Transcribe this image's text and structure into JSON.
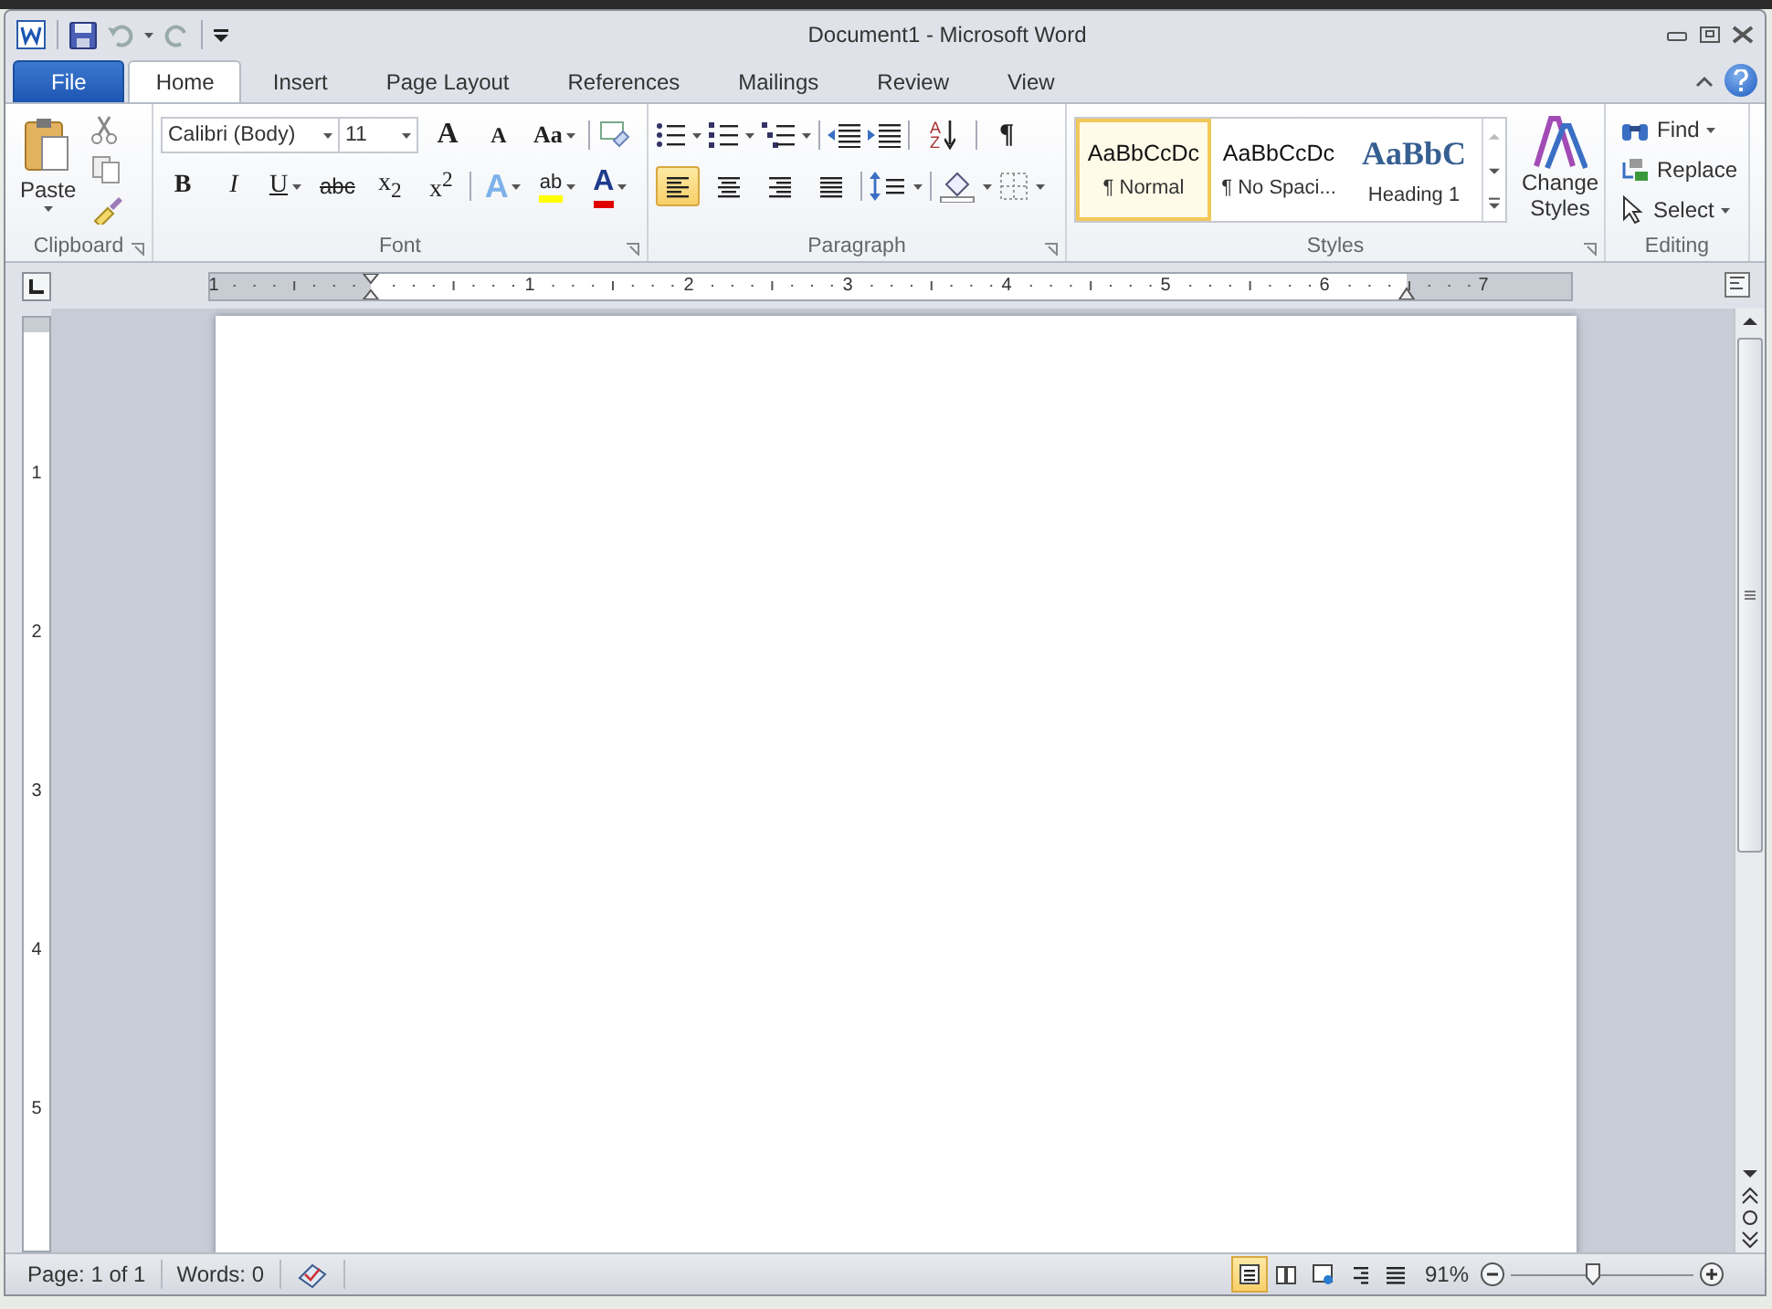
{
  "window": {
    "title": "Document1 - Microsoft Word"
  },
  "tabs": [
    {
      "label": "File",
      "kind": "file",
      "selected": false
    },
    {
      "label": "Home",
      "kind": "tab",
      "selected": true
    },
    {
      "label": "Insert",
      "kind": "tab",
      "selected": false
    },
    {
      "label": "Page Layout",
      "kind": "tab",
      "selected": false
    },
    {
      "label": "References",
      "kind": "tab",
      "selected": false
    },
    {
      "label": "Mailings",
      "kind": "tab",
      "selected": false
    },
    {
      "label": "Review",
      "kind": "tab",
      "selected": false
    },
    {
      "label": "View",
      "kind": "tab",
      "selected": false
    }
  ],
  "clipboard": {
    "paste": "Paste",
    "label": "Clipboard"
  },
  "font": {
    "family": "Calibri (Body)",
    "size": "11",
    "label": "Font",
    "tools": [
      {
        "kind": "grow",
        "label": "A"
      },
      {
        "kind": "shrink",
        "label": "A"
      },
      {
        "kind": "case",
        "label": "Aa"
      }
    ],
    "formats": [
      {
        "kind": "bold",
        "label": "B"
      },
      {
        "kind": "italic",
        "label": "I"
      },
      {
        "kind": "underline",
        "label": "U"
      },
      {
        "kind": "strike",
        "label": "abc"
      },
      {
        "kind": "sub",
        "label": "x$_{2}$"
      },
      {
        "kind": "sup",
        "label": "x$^{2}$"
      }
    ],
    "colors": [
      {
        "kind": "effects",
        "label": "A"
      },
      {
        "kind": "highlight",
        "label": "ab",
        "color": "#ffff00"
      },
      {
        "kind": "fontcolor",
        "label": "A",
        "color": "#e00000"
      }
    ]
  },
  "paragraph": {
    "label": "Paragraph",
    "pilcrow": "¶",
    "sort_label": "A Z",
    "align": [
      {
        "kind": "left",
        "selected": true
      },
      {
        "kind": "center",
        "selected": false
      },
      {
        "kind": "right",
        "selected": false
      },
      {
        "kind": "justify",
        "selected": false
      }
    ]
  },
  "styles": {
    "label": "Styles",
    "change": "Change Styles",
    "items": [
      {
        "kind": "normal",
        "preview": "AaBbCcDc",
        "name": "¶ Normal",
        "selected": true
      },
      {
        "kind": "normal",
        "preview": "AaBbCcDc",
        "name": "¶ No Spaci...",
        "selected": false
      },
      {
        "kind": "heading",
        "preview": "AaBbC",
        "name": "Heading 1",
        "selected": false
      }
    ]
  },
  "editing": {
    "label": "Editing",
    "items": [
      {
        "kind": "find",
        "label": "Find"
      },
      {
        "kind": "replace",
        "label": "Replace"
      },
      {
        "kind": "select",
        "label": "Select"
      }
    ]
  },
  "ruler": {
    "labels": [
      "1",
      "1",
      "2",
      "3",
      "4",
      "5",
      "6",
      "7"
    ],
    "vertical_labels": [
      "1",
      "2",
      "3",
      "4",
      "5"
    ]
  },
  "status_bar": {
    "page": "Page: 1 of 1",
    "words": "Words: 0",
    "zoom": "91%",
    "zoom_slider": {
      "level": 0.45
    },
    "views": [
      {
        "kind": "print",
        "selected": true
      },
      {
        "kind": "reading",
        "selected": false
      },
      {
        "kind": "web",
        "selected": false
      },
      {
        "kind": "outline",
        "selected": false
      },
      {
        "kind": "draft",
        "selected": false
      }
    ]
  }
}
